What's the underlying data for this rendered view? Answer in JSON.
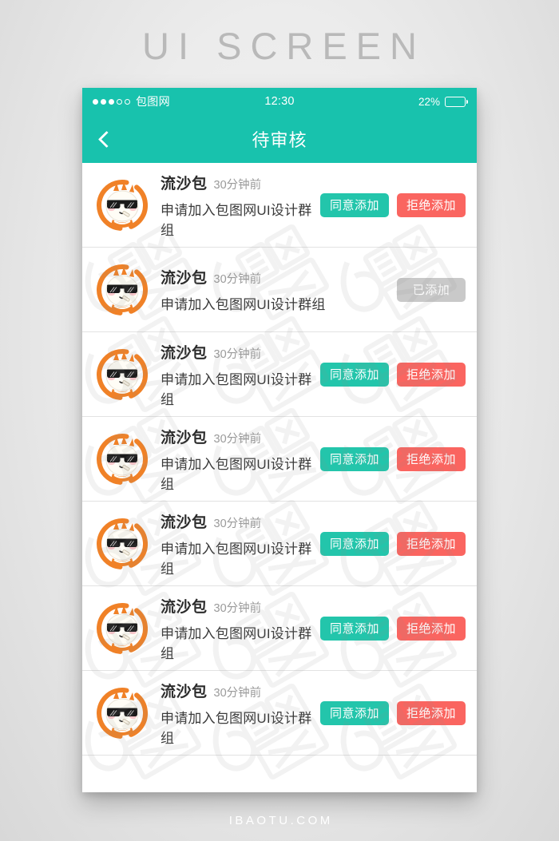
{
  "poster": {
    "title": "UI SCREEN",
    "footer": "IBAOTU.COM"
  },
  "theme": {
    "accent": "#18c2ad",
    "accept_button": "#23c5ab",
    "reject_button": "#fa6560",
    "done_button": "#c9c9c9",
    "avatar_orange": "#f08127",
    "page_background": "#ececec"
  },
  "statusbar": {
    "signal_filled_dots": 3,
    "signal_hollow_dots": 2,
    "carrier": "包图网",
    "time": "12:30",
    "battery_percent": "22%",
    "battery_level": 22
  },
  "navbar": {
    "back_icon": "chevron-left-icon",
    "title": "待审核"
  },
  "list": {
    "rows": [
      {
        "avatar_icon": "cartoon-bun-avatar",
        "name": "流沙包",
        "time": "30分钟前",
        "description": "申请加入包图网UI设计群组",
        "state": "pending",
        "accept_label": "同意添加",
        "reject_label": "拒绝添加"
      },
      {
        "avatar_icon": "cartoon-bun-avatar",
        "name": "流沙包",
        "time": "30分钟前",
        "description": "申请加入包图网UI设计群组",
        "state": "added",
        "added_label": "已添加"
      },
      {
        "avatar_icon": "cartoon-bun-avatar",
        "name": "流沙包",
        "time": "30分钟前",
        "description": "申请加入包图网UI设计群组",
        "state": "pending",
        "accept_label": "同意添加",
        "reject_label": "拒绝添加"
      },
      {
        "avatar_icon": "cartoon-bun-avatar",
        "name": "流沙包",
        "time": "30分钟前",
        "description": "申请加入包图网UI设计群组",
        "state": "pending",
        "accept_label": "同意添加",
        "reject_label": "拒绝添加"
      },
      {
        "avatar_icon": "cartoon-bun-avatar",
        "name": "流沙包",
        "time": "30分钟前",
        "description": "申请加入包图网UI设计群组",
        "state": "pending",
        "accept_label": "同意添加",
        "reject_label": "拒绝添加"
      },
      {
        "avatar_icon": "cartoon-bun-avatar",
        "name": "流沙包",
        "time": "30分钟前",
        "description": "申请加入包图网UI设计群组",
        "state": "pending",
        "accept_label": "同意添加",
        "reject_label": "拒绝添加"
      },
      {
        "avatar_icon": "cartoon-bun-avatar",
        "name": "流沙包",
        "time": "30分钟前",
        "description": "申请加入包图网UI设计群组",
        "state": "pending",
        "accept_label": "同意添加",
        "reject_label": "拒绝添加"
      }
    ]
  },
  "watermark": {
    "text": "包图网"
  }
}
